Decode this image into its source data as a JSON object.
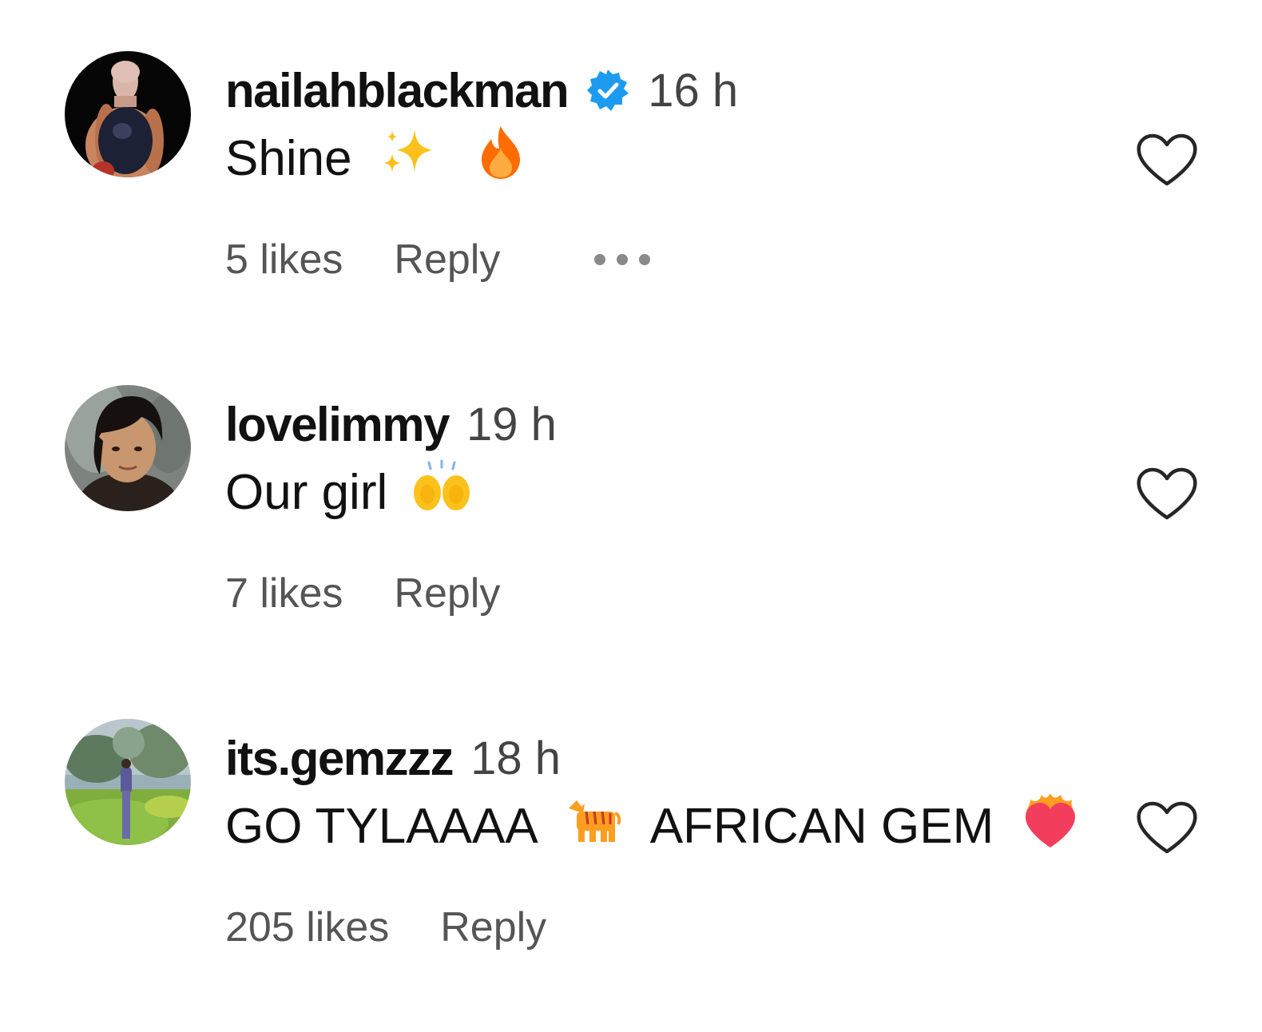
{
  "comments": [
    {
      "username": "nailahblackman",
      "verified": true,
      "time": "16 h",
      "text": "Shine",
      "emojis": [
        "sparkles-emoji",
        "fire-emoji"
      ],
      "likes": "5 likes",
      "reply": "Reply",
      "has_more_menu": true
    },
    {
      "username": "lovelimmy",
      "verified": false,
      "time": "19 h",
      "text": "Our girl",
      "emojis": [
        "raising-hands-emoji"
      ],
      "likes": "7 likes",
      "reply": "Reply",
      "has_more_menu": false
    },
    {
      "username": "its.gemzzz",
      "verified": false,
      "time": "18 h",
      "text_part1": "GO TYLAAAA",
      "text_part2": "AFRICAN GEM",
      "emojis": [
        "tiger-emoji",
        "heart-on-fire-emoji"
      ],
      "likes": "205 likes",
      "reply": "Reply",
      "has_more_menu": false
    }
  ],
  "colors": {
    "text": "#111111",
    "secondary_text": "#555555",
    "verified_blue": "#1d9bf0",
    "heart_outline": "#262626",
    "more_dots": "#8a8a8a"
  },
  "icons": {
    "like": "heart-outline-icon",
    "verified": "verified-badge-icon",
    "more": "more-options-icon"
  }
}
